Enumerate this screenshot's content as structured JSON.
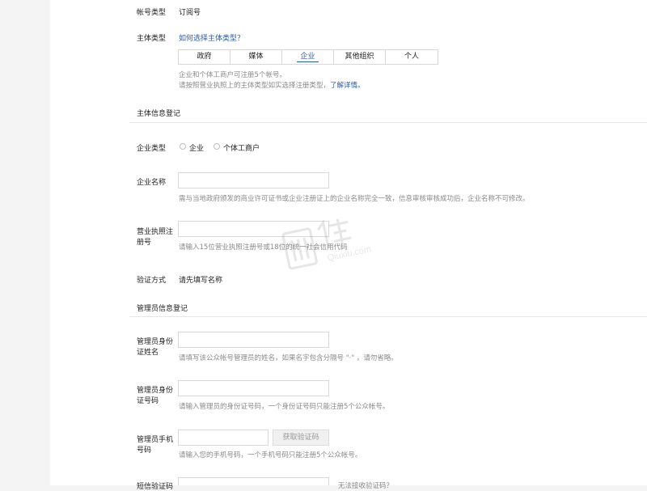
{
  "account_type": {
    "label": "帐号类型",
    "value": "订阅号"
  },
  "subject_type": {
    "label": "主体类型",
    "help_link": "如何选择主体类型？",
    "tabs": [
      "政府",
      "媒体",
      "企业",
      "其他组织",
      "个人"
    ],
    "active_tab": "企业",
    "note_line1": "企业和个体工商户可注册5个帐号。",
    "note_line2_prefix": "请按照营业执照上的主体类型如实选择注册类型，",
    "note_line2_link": "了解详情。"
  },
  "subject_info": {
    "section_title": "主体信息登记",
    "company_type": {
      "label": "企业类型",
      "options": [
        "企业",
        "个体工商户"
      ]
    },
    "company_name": {
      "label": "企业名称",
      "value": "",
      "hint": "需与当地政府颁发的商业许可证书或企业注册证上的企业名称完全一致，信息审核审核成功后，企业名称不可修改。"
    },
    "license_no": {
      "label_line1": "营业执照注",
      "label_line2": "册号",
      "value": "",
      "hint": "请输入15位营业执照注册号或18位的统一社会信用代码"
    },
    "verify_method": {
      "label": "验证方式",
      "value": "请先填写名称"
    }
  },
  "admin_info": {
    "section_title": "管理员信息登记",
    "admin_name": {
      "label_line1": "管理员身份",
      "label_line2": "证姓名",
      "value": "",
      "hint": "请填写该公众帐号管理员的姓名，如果名字包含分隔号 \"·\" ，请勿省略。"
    },
    "admin_id": {
      "label_line1": "管理员身份",
      "label_line2": "证号码",
      "value": "",
      "hint": "请输入管理员的身份证号码，一个身份证号码只能注册5个公众帐号。"
    },
    "admin_phone": {
      "label_line1": "管理员手机",
      "label_line2": "号码",
      "value": "",
      "button": "获取验证码",
      "hint": "请输入您的手机号码，一个手机号码只能注册5个公众帐号。"
    },
    "sms_code": {
      "label": "短信验证码",
      "link": "无法接收验证码？"
    }
  },
  "watermark": {
    "text": "Qiuxiu.com"
  }
}
